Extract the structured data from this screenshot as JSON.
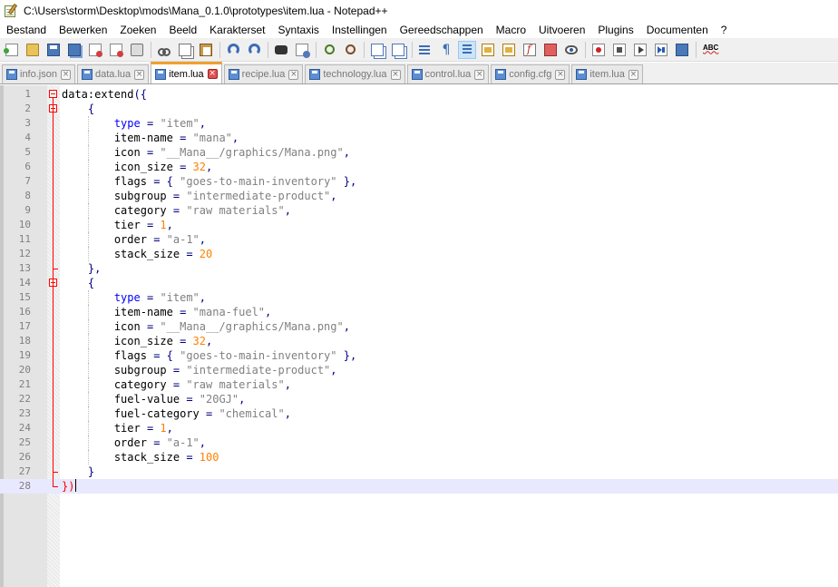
{
  "window": {
    "title": "C:\\Users\\storm\\Desktop\\mods\\Mana_0.1.0\\prototypes\\item.lua - Notepad++"
  },
  "menu": [
    {
      "label": "Bestand"
    },
    {
      "label": "Bewerken"
    },
    {
      "label": "Zoeken"
    },
    {
      "label": "Beeld"
    },
    {
      "label": "Karakterset"
    },
    {
      "label": "Syntaxis"
    },
    {
      "label": "Instellingen"
    },
    {
      "label": "Gereedschappen"
    },
    {
      "label": "Macro"
    },
    {
      "label": "Uitvoeren"
    },
    {
      "label": "Plugins"
    },
    {
      "label": "Documenten"
    },
    {
      "label": "?"
    }
  ],
  "toolbar": [
    {
      "name": "new-file",
      "icon": "new-file-icon"
    },
    {
      "name": "open-file",
      "icon": "folder-icon"
    },
    {
      "name": "save",
      "icon": "save-icon"
    },
    {
      "name": "save-all",
      "icon": "save-all-icon"
    },
    {
      "name": "close",
      "icon": "close-file-icon"
    },
    {
      "name": "close-all",
      "icon": "close-all-icon"
    },
    {
      "name": "print",
      "icon": "printer-icon"
    },
    {
      "sep": true
    },
    {
      "name": "cut",
      "icon": "scissors-icon"
    },
    {
      "name": "copy",
      "icon": "copy-icon"
    },
    {
      "name": "paste",
      "icon": "paste-icon"
    },
    {
      "sep": true
    },
    {
      "name": "undo",
      "icon": "undo-icon"
    },
    {
      "name": "redo",
      "icon": "redo-icon"
    },
    {
      "sep": true
    },
    {
      "name": "find",
      "icon": "binoculars-icon"
    },
    {
      "name": "replace",
      "icon": "replace-icon"
    },
    {
      "sep": true
    },
    {
      "name": "zoom-in",
      "icon": "zoom-in-icon"
    },
    {
      "name": "zoom-out",
      "icon": "zoom-out-icon"
    },
    {
      "sep": true
    },
    {
      "name": "sync-vertical",
      "icon": "sync-vertical-icon"
    },
    {
      "name": "sync-horizontal",
      "icon": "sync-horizontal-icon"
    },
    {
      "sep": true
    },
    {
      "name": "word-wrap",
      "icon": "word-wrap-icon"
    },
    {
      "name": "show-all-chars",
      "icon": "pilcrow-icon"
    },
    {
      "name": "indent-guide",
      "icon": "indent-guide-icon",
      "active": true
    },
    {
      "name": "user-language",
      "icon": "user-language-icon"
    },
    {
      "name": "doc-map",
      "icon": "document-map-icon"
    },
    {
      "name": "function-list",
      "icon": "function-list-icon"
    },
    {
      "name": "folder-workspace",
      "icon": "folder-workspace-icon"
    },
    {
      "name": "monitoring",
      "icon": "eye-icon"
    },
    {
      "sep": true
    },
    {
      "name": "record-macro",
      "icon": "record-icon"
    },
    {
      "name": "stop-macro",
      "icon": "stop-icon"
    },
    {
      "name": "play-macro",
      "icon": "play-icon"
    },
    {
      "name": "run-macro-multiple",
      "icon": "play-multiple-icon"
    },
    {
      "name": "save-macro",
      "icon": "save-macro-icon"
    },
    {
      "sep": true
    },
    {
      "name": "spell-check",
      "icon": "spell-check-icon",
      "label": "ABC"
    }
  ],
  "tabs": [
    {
      "label": "info.json",
      "active": false
    },
    {
      "label": "data.lua",
      "active": false
    },
    {
      "label": "item.lua",
      "active": true
    },
    {
      "label": "recipe.lua",
      "active": false
    },
    {
      "label": "technology.lua",
      "active": false
    },
    {
      "label": "control.lua",
      "active": false
    },
    {
      "label": "config.cfg",
      "active": false
    },
    {
      "label": "item.lua",
      "active": false
    }
  ],
  "editor": {
    "current_line": 28,
    "lines": [
      {
        "n": "1",
        "indent": 0,
        "tokens": [
          [
            "plain",
            "data:extend"
          ],
          [
            "op",
            "({"
          ]
        ]
      },
      {
        "n": "2",
        "indent": 1,
        "tokens": [
          [
            "op",
            "{"
          ]
        ]
      },
      {
        "n": "3",
        "indent": 2,
        "tokens": [
          [
            "kw",
            "type"
          ],
          [
            "plain",
            " "
          ],
          [
            "op",
            "="
          ],
          [
            "plain",
            " "
          ],
          [
            "str",
            "\"item\""
          ],
          [
            "op",
            ","
          ]
        ]
      },
      {
        "n": "4",
        "indent": 2,
        "tokens": [
          [
            "plain",
            "item-name "
          ],
          [
            "op",
            "="
          ],
          [
            "plain",
            " "
          ],
          [
            "str",
            "\"mana\""
          ],
          [
            "op",
            ","
          ]
        ]
      },
      {
        "n": "5",
        "indent": 2,
        "tokens": [
          [
            "plain",
            "icon "
          ],
          [
            "op",
            "="
          ],
          [
            "plain",
            " "
          ],
          [
            "str",
            "\"__Mana__/graphics/Mana.png\""
          ],
          [
            "op",
            ","
          ]
        ]
      },
      {
        "n": "6",
        "indent": 2,
        "tokens": [
          [
            "plain",
            "icon_size "
          ],
          [
            "op",
            "="
          ],
          [
            "plain",
            " "
          ],
          [
            "num",
            "32"
          ],
          [
            "op",
            ","
          ]
        ]
      },
      {
        "n": "7",
        "indent": 2,
        "tokens": [
          [
            "plain",
            "flags "
          ],
          [
            "op",
            "="
          ],
          [
            "plain",
            " "
          ],
          [
            "op",
            "{"
          ],
          [
            "plain",
            " "
          ],
          [
            "str",
            "\"goes-to-main-inventory\""
          ],
          [
            "plain",
            " "
          ],
          [
            "op",
            "},"
          ]
        ]
      },
      {
        "n": "8",
        "indent": 2,
        "tokens": [
          [
            "plain",
            "subgroup "
          ],
          [
            "op",
            "="
          ],
          [
            "plain",
            " "
          ],
          [
            "str",
            "\"intermediate-product\""
          ],
          [
            "op",
            ","
          ]
        ]
      },
      {
        "n": "9",
        "indent": 2,
        "tokens": [
          [
            "plain",
            "category "
          ],
          [
            "op",
            "="
          ],
          [
            "plain",
            " "
          ],
          [
            "str",
            "\"raw materials\""
          ],
          [
            "op",
            ","
          ]
        ]
      },
      {
        "n": "10",
        "indent": 2,
        "tokens": [
          [
            "plain",
            "tier "
          ],
          [
            "op",
            "="
          ],
          [
            "plain",
            " "
          ],
          [
            "num",
            "1"
          ],
          [
            "op",
            ","
          ]
        ]
      },
      {
        "n": "11",
        "indent": 2,
        "tokens": [
          [
            "plain",
            "order "
          ],
          [
            "op",
            "="
          ],
          [
            "plain",
            " "
          ],
          [
            "str",
            "\"a-1\""
          ],
          [
            "op",
            ","
          ]
        ]
      },
      {
        "n": "12",
        "indent": 2,
        "tokens": [
          [
            "plain",
            "stack_size "
          ],
          [
            "op",
            "="
          ],
          [
            "plain",
            " "
          ],
          [
            "num",
            "20"
          ]
        ]
      },
      {
        "n": "13",
        "indent": 1,
        "tokens": [
          [
            "op",
            "},"
          ]
        ]
      },
      {
        "n": "14",
        "indent": 1,
        "tokens": [
          [
            "op",
            "{"
          ]
        ]
      },
      {
        "n": "15",
        "indent": 2,
        "tokens": [
          [
            "kw",
            "type"
          ],
          [
            "plain",
            " "
          ],
          [
            "op",
            "="
          ],
          [
            "plain",
            " "
          ],
          [
            "str",
            "\"item\""
          ],
          [
            "op",
            ","
          ]
        ]
      },
      {
        "n": "16",
        "indent": 2,
        "tokens": [
          [
            "plain",
            "item-name "
          ],
          [
            "op",
            "="
          ],
          [
            "plain",
            " "
          ],
          [
            "str",
            "\"mana-fuel\""
          ],
          [
            "op",
            ","
          ]
        ]
      },
      {
        "n": "17",
        "indent": 2,
        "tokens": [
          [
            "plain",
            "icon "
          ],
          [
            "op",
            "="
          ],
          [
            "plain",
            " "
          ],
          [
            "str",
            "\"__Mana__/graphics/Mana.png\""
          ],
          [
            "op",
            ","
          ]
        ]
      },
      {
        "n": "18",
        "indent": 2,
        "tokens": [
          [
            "plain",
            "icon_size "
          ],
          [
            "op",
            "="
          ],
          [
            "plain",
            " "
          ],
          [
            "num",
            "32"
          ],
          [
            "op",
            ","
          ]
        ]
      },
      {
        "n": "19",
        "indent": 2,
        "tokens": [
          [
            "plain",
            "flags "
          ],
          [
            "op",
            "="
          ],
          [
            "plain",
            " "
          ],
          [
            "op",
            "{"
          ],
          [
            "plain",
            " "
          ],
          [
            "str",
            "\"goes-to-main-inventory\""
          ],
          [
            "plain",
            " "
          ],
          [
            "op",
            "},"
          ]
        ]
      },
      {
        "n": "20",
        "indent": 2,
        "tokens": [
          [
            "plain",
            "subgroup "
          ],
          [
            "op",
            "="
          ],
          [
            "plain",
            " "
          ],
          [
            "str",
            "\"intermediate-product\""
          ],
          [
            "op",
            ","
          ]
        ]
      },
      {
        "n": "21",
        "indent": 2,
        "tokens": [
          [
            "plain",
            "category "
          ],
          [
            "op",
            "="
          ],
          [
            "plain",
            " "
          ],
          [
            "str",
            "\"raw materials\""
          ],
          [
            "op",
            ","
          ]
        ]
      },
      {
        "n": "22",
        "indent": 2,
        "tokens": [
          [
            "plain",
            "fuel-value "
          ],
          [
            "op",
            "="
          ],
          [
            "plain",
            " "
          ],
          [
            "str",
            "\"20GJ\""
          ],
          [
            "op",
            ","
          ]
        ]
      },
      {
        "n": "23",
        "indent": 2,
        "tokens": [
          [
            "plain",
            "fuel-category "
          ],
          [
            "op",
            "="
          ],
          [
            "plain",
            " "
          ],
          [
            "str",
            "\"chemical\""
          ],
          [
            "op",
            ","
          ]
        ]
      },
      {
        "n": "24",
        "indent": 2,
        "tokens": [
          [
            "plain",
            "tier "
          ],
          [
            "op",
            "="
          ],
          [
            "plain",
            " "
          ],
          [
            "num",
            "1"
          ],
          [
            "op",
            ","
          ]
        ]
      },
      {
        "n": "25",
        "indent": 2,
        "tokens": [
          [
            "plain",
            "order "
          ],
          [
            "op",
            "="
          ],
          [
            "plain",
            " "
          ],
          [
            "str",
            "\"a-1\""
          ],
          [
            "op",
            ","
          ]
        ]
      },
      {
        "n": "26",
        "indent": 2,
        "tokens": [
          [
            "plain",
            "stack_size "
          ],
          [
            "op",
            "="
          ],
          [
            "plain",
            " "
          ],
          [
            "num",
            "100"
          ]
        ]
      },
      {
        "n": "27",
        "indent": 1,
        "tokens": [
          [
            "op",
            "}"
          ]
        ]
      },
      {
        "n": "28",
        "indent": 0,
        "tokens": [
          [
            "op",
            "})"
          ]
        ]
      }
    ]
  }
}
